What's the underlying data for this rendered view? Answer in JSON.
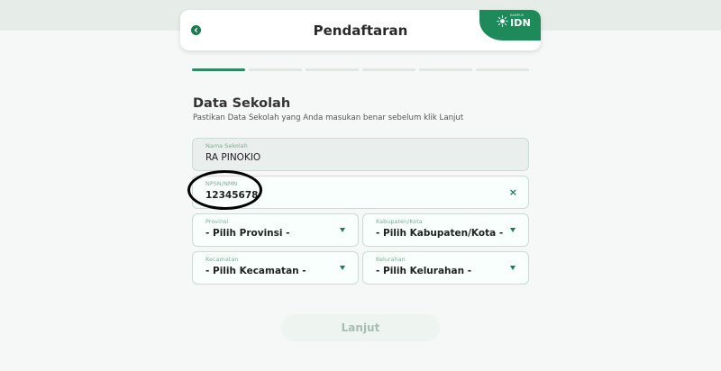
{
  "header": {
    "title": "Pendaftaran",
    "brand": {
      "small": "KAMPUS",
      "name": "IDN"
    }
  },
  "progress": {
    "total_steps": 6,
    "current_step": 1
  },
  "section": {
    "title": "Data Sekolah",
    "subtitle": "Pastikan Data Sekolah yang Anda masukan benar sebelum klik Lanjut"
  },
  "form": {
    "school_name": {
      "label": "Nama Sekolah",
      "value": "RA PINOKIO"
    },
    "npsn": {
      "label": "NPSN/NMN",
      "value": "12345678",
      "clear_icon": "×"
    },
    "province": {
      "label": "Provinsi",
      "value": "- Pilih Provinsi -"
    },
    "city": {
      "label": "Kabupaten/Kota",
      "value": "- Pilih Kabupaten/Kota -"
    },
    "district": {
      "label": "Kecamatan",
      "value": "- Pilih Kecamatan -"
    },
    "village": {
      "label": "Kelurahan",
      "value": "- Pilih Kelurahan -"
    }
  },
  "submit": {
    "label": "Lanjut"
  },
  "colors": {
    "accent": "#1e8a5a",
    "background": "#f5f8f6",
    "field_border": "#c9ded3",
    "disabled_button": "#eef4f0"
  }
}
